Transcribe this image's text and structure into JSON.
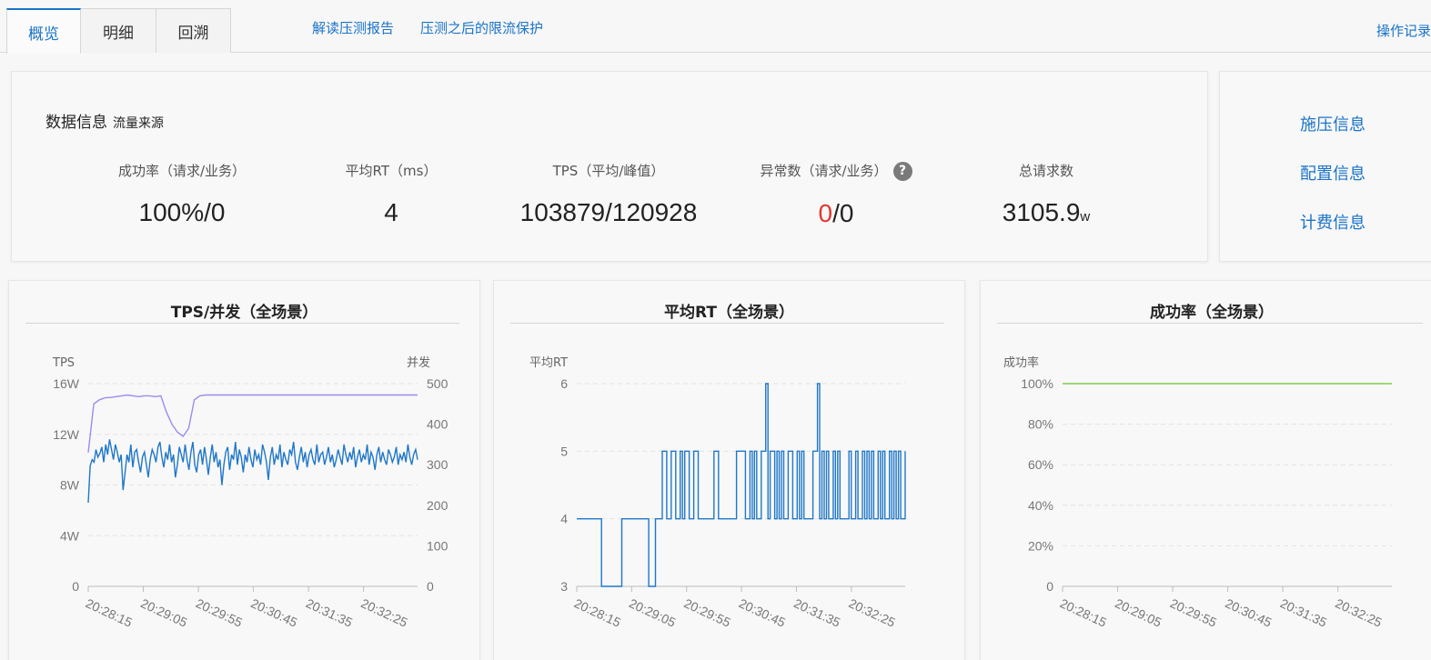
{
  "tabs": [
    {
      "label": "概览",
      "active": true
    },
    {
      "label": "明细",
      "active": false
    },
    {
      "label": "回溯",
      "active": false
    }
  ],
  "links": {
    "report": "解读压测报告",
    "protect": "压测之后的限流保护",
    "oplog": "操作记录"
  },
  "info": {
    "title": "数据信息",
    "subtitle": "流量来源",
    "metrics": [
      {
        "label": "成功率（请求/业务）",
        "value": "100%/0"
      },
      {
        "label": "平均RT（ms）",
        "value": "4"
      },
      {
        "label": "TPS（平均/峰值）",
        "value": "103879/120928"
      },
      {
        "label": "异常数（请求/业务）",
        "value_red": "0",
        "value_rest": "/0",
        "help": "?"
      },
      {
        "label": "总请求数",
        "value": "3105.9",
        "unit": "w"
      }
    ]
  },
  "side": {
    "items": [
      "施压信息",
      "配置信息",
      "计费信息"
    ]
  },
  "colors": {
    "accent": "#1a73c9",
    "tps": "#1f77c9",
    "concurrency": "#9b8cf0",
    "success": "#7ccc4a",
    "error": "#e03a2f"
  },
  "charts": [
    {
      "title": "TPS/并发（全场景）",
      "chart_data": {
        "type": "line",
        "ylabel": "TPS",
        "y2label": "并发",
        "ylim": [
          0,
          160000
        ],
        "y2lim": [
          0,
          500
        ],
        "yticks": [
          "0",
          "4W",
          "8W",
          "12W",
          "16W"
        ],
        "y2ticks": [
          "0",
          "100",
          "200",
          "300",
          "400",
          "500"
        ],
        "xticks": [
          "20:28:15",
          "20:29:05",
          "20:29:55",
          "20:30:45",
          "20:31:35",
          "20:32:25"
        ],
        "series": [
          {
            "name": "TPS",
            "values": [
              66000,
              95000,
              100000,
              98000,
              108000,
              102000,
              105000,
              110000,
              98000,
              112000,
              104000,
              116000,
              108000,
              100000,
              112000,
              106000,
              98000,
              104000,
              76000,
              90000,
              104000,
              98000,
              112000,
              94000,
              106000,
              108000,
              98000,
              90000,
              102000,
              106000,
              96000,
              86000,
              100000,
              108000,
              104000,
              98000,
              110000,
              114000,
              102000,
              94000,
              106000,
              100000,
              112000,
              98000,
              104000,
              86000,
              96000,
              110000,
              104000,
              98000,
              112000,
              100000,
              92000,
              106000,
              114000,
              96000,
              90000,
              104000,
              108000,
              96000,
              110000,
              100000,
              88000,
              102000,
              112000,
              98000,
              106000,
              94000,
              100000,
              80000,
              96000,
              106000,
              110000,
              92000,
              104000,
              100000,
              114000,
              96000,
              108000,
              102000,
              90000,
              104000,
              98000,
              110000,
              100000,
              94000,
              108000,
              100000,
              104000,
              96000,
              112000,
              106000,
              98000,
              84000,
              102000,
              110000,
              96000,
              104000,
              100000,
              112000,
              94000,
              106000,
              100000,
              96000,
              108000,
              104000,
              114000,
              98000,
              92000,
              102000,
              110000,
              98000,
              106000,
              94000,
              104000,
              108000,
              100000,
              96000,
              112000,
              98000,
              104000,
              106000,
              96000,
              102000,
              110000,
              98000,
              104000,
              94000,
              100000,
              108000,
              102000,
              96000,
              112000,
              104000,
              98000,
              106000,
              100000,
              110000,
              94000,
              102000,
              108000,
              98000,
              104000,
              100000,
              112000,
              96000,
              106000,
              102000,
              92000,
              104000,
              110000,
              98000,
              106000,
              100000,
              96000,
              108000,
              104000,
              98000,
              102000,
              110000,
              96000,
              104000,
              100000,
              106000,
              98000,
              112000,
              102000,
              96000,
              104000,
              108000,
              100000
            ]
          },
          {
            "name": "并发",
            "values": [
              330,
              450,
              460,
              465,
              466,
              468,
              470,
              472,
              470,
              468,
              470,
              470,
              468,
              470,
              430,
              400,
              380,
              370,
              390,
              460,
              470,
              472,
              472,
              472,
              472,
              472,
              472,
              472,
              472,
              472,
              472,
              472,
              472,
              472,
              472,
              472,
              472,
              472,
              472,
              472,
              472,
              472,
              472,
              472,
              472,
              472,
              472,
              472,
              472,
              472,
              472,
              472,
              472,
              472,
              472,
              472,
              472,
              472,
              472,
              472
            ]
          }
        ]
      }
    },
    {
      "title": "平均RT（全场景）",
      "chart_data": {
        "type": "line",
        "ylabel": "平均RT",
        "ylim": [
          3,
          6
        ],
        "yticks": [
          "3",
          "4",
          "5",
          "6"
        ],
        "xticks": [
          "20:28:15",
          "20:29:05",
          "20:29:55",
          "20:30:45",
          "20:31:35",
          "20:32:25"
        ],
        "series": [
          {
            "name": "平均RT",
            "values": [
              4,
              4,
              4,
              4,
              4,
              4,
              4,
              4,
              4,
              4,
              4,
              3,
              3,
              3,
              3,
              3,
              3,
              3,
              3,
              3,
              4,
              4,
              4,
              4,
              4,
              4,
              4,
              4,
              4,
              4,
              4,
              4,
              3,
              3,
              3,
              4,
              4,
              4,
              5,
              5,
              4,
              4,
              5,
              5,
              4,
              4,
              5,
              4,
              5,
              5,
              4,
              4,
              5,
              5,
              4,
              4,
              4,
              4,
              4,
              4,
              4,
              5,
              5,
              4,
              4,
              4,
              4,
              4,
              4,
              4,
              4,
              5,
              5,
              5,
              5,
              4,
              4,
              5,
              4,
              5,
              4,
              4,
              5,
              5,
              6,
              4,
              5,
              5,
              4,
              5,
              4,
              5,
              4,
              4,
              5,
              5,
              4,
              4,
              5,
              4,
              5,
              4,
              4,
              4,
              4,
              5,
              5,
              6,
              4,
              5,
              4,
              5,
              4,
              4,
              5,
              4,
              5,
              4,
              4,
              4,
              4,
              5,
              4,
              4,
              5,
              4,
              4,
              5,
              4,
              5,
              4,
              5,
              4,
              4,
              5,
              4,
              5,
              4,
              4,
              5,
              4,
              5,
              4,
              5,
              4,
              4,
              5
            ]
          }
        ]
      }
    },
    {
      "title": "成功率（全场景）",
      "chart_data": {
        "type": "line",
        "ylabel": "成功率",
        "ylim": [
          0,
          100
        ],
        "yticks": [
          "0",
          "20%",
          "40%",
          "60%",
          "80%",
          "100%"
        ],
        "xticks": [
          "20:28:15",
          "20:29:05",
          "20:29:55",
          "20:30:45",
          "20:31:35",
          "20:32:25"
        ],
        "series": [
          {
            "name": "成功率",
            "values": [
              100,
              100
            ]
          }
        ]
      }
    }
  ]
}
